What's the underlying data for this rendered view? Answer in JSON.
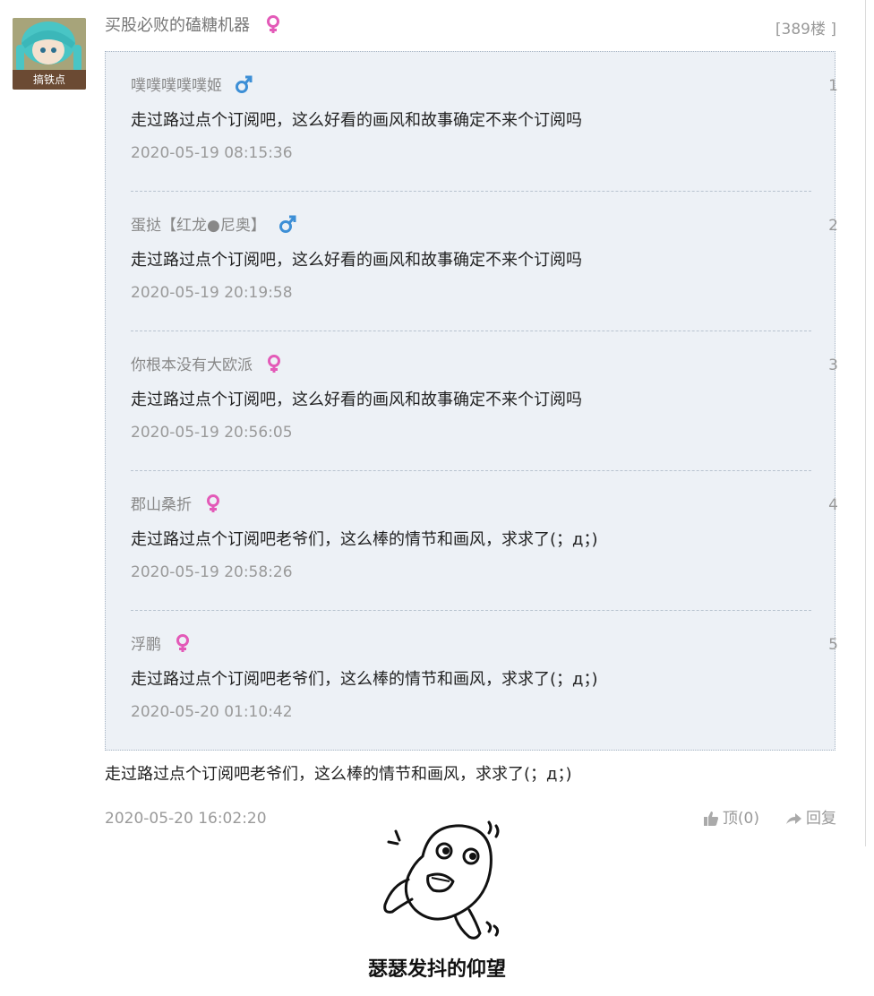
{
  "post": {
    "avatar_tag": "搞铁点",
    "author": "买股必败的磕糖机器",
    "author_gender": "female",
    "floor_label": "[389楼 ]",
    "text": "走过路过点个订阅吧老爷们，这么棒的情节和画风，求求了(；д；)",
    "time": "2020-05-20 16:02:20",
    "like_label": "顶(0)",
    "reply_label": "回复"
  },
  "replies": [
    {
      "user": "噗噗噗噗噗姬",
      "gender": "male",
      "num": "1",
      "text": "走过路过点个订阅吧，这么好看的画风和故事确定不来个订阅吗",
      "time": "2020-05-19 08:15:36"
    },
    {
      "user": "蛋挞【红龙●尼奥】",
      "gender": "male",
      "num": "2",
      "text": "走过路过点个订阅吧，这么好看的画风和故事确定不来个订阅吗",
      "time": "2020-05-19 20:19:58"
    },
    {
      "user": "你根本没有大欧派",
      "gender": "female",
      "num": "3",
      "text": "走过路过点个订阅吧，这么好看的画风和故事确定不来个订阅吗",
      "time": "2020-05-19 20:56:05"
    },
    {
      "user": "郡山桑折",
      "gender": "female",
      "num": "4",
      "text": "走过路过点个订阅吧老爷们，这么棒的情节和画风，求求了(；д；)",
      "time": "2020-05-19 20:58:26"
    },
    {
      "user": "浮鹏",
      "gender": "female",
      "num": "5",
      "text": "走过路过点个订阅吧老爷们，这么棒的情节和画风，求求了(；д；)",
      "time": "2020-05-20 01:10:42"
    }
  ],
  "meme": {
    "caption": "瑟瑟发抖的仰望"
  },
  "colors": {
    "male": "#3d8fd6",
    "female": "#e35ab8",
    "panel_bg": "#edf1f6"
  },
  "icons": [
    "female-icon",
    "male-icon",
    "thumbs-up-icon",
    "reply-arrow-icon"
  ]
}
